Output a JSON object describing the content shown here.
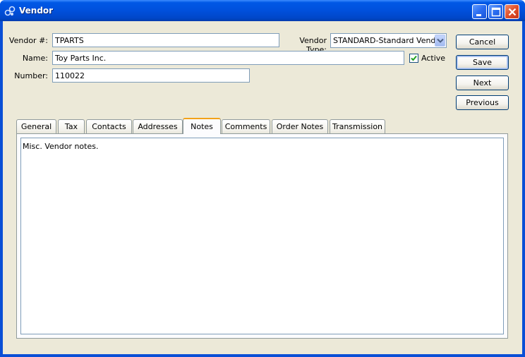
{
  "window": {
    "title": "Vendor",
    "icon": "vendor-app-icon"
  },
  "form": {
    "vendor_number_label": "Vendor #:",
    "vendor_number_value": "TPARTS",
    "vendor_type_label": "Vendor Type:",
    "vendor_type_value": "STANDARD-Standard Vendor",
    "name_label": "Name:",
    "name_value": "Toy Parts Inc.",
    "active_label": "Active",
    "active_checked": true,
    "number_label": "Number:",
    "number_value": "110022"
  },
  "buttons": {
    "cancel": "Cancel",
    "save": "Save",
    "next": "Next",
    "previous": "Previous"
  },
  "tabs": [
    {
      "label": "General"
    },
    {
      "label": "Tax"
    },
    {
      "label": "Contacts"
    },
    {
      "label": "Addresses"
    },
    {
      "label": "Notes",
      "active": true
    },
    {
      "label": "Comments"
    },
    {
      "label": "Order Notes"
    },
    {
      "label": "Transmission"
    }
  ],
  "notes_text": "Misc. Vendor notes.",
  "colors": {
    "titlebar": "#0054e3",
    "client_bg": "#ece9d8",
    "active_tab_accent": "#f2a21a",
    "close_button": "#e0502a"
  }
}
